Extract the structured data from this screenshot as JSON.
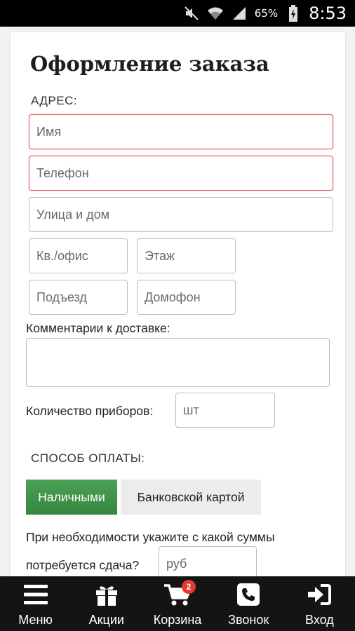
{
  "status_bar": {
    "battery_percent": "65%",
    "time": "8:53",
    "icons": [
      "mute-icon",
      "wifi-icon",
      "signal-icon",
      "battery-charging-icon"
    ]
  },
  "page": {
    "title": "Оформление заказа"
  },
  "address": {
    "label": "АДРЕС:",
    "name_placeholder": "Имя",
    "phone_placeholder": "Телефон",
    "street_placeholder": "Улица и дом",
    "apartment_placeholder": "Кв./офис",
    "floor_placeholder": "Этаж",
    "entrance_placeholder": "Подъезд",
    "intercom_placeholder": "Домофон"
  },
  "delivery": {
    "comment_label": "Комментарии к доставке:",
    "comment_value": "",
    "cutlery_label": "Количество приборов:",
    "cutlery_placeholder": "шт"
  },
  "payment": {
    "label": "СПОСОБ ОПЛАТЫ:",
    "options": [
      "Наличными",
      "Банковской картой"
    ],
    "selected": "Наличными",
    "change_line1": "При необходимости укажите с какой суммы",
    "change_line2": "потребуется сдача?",
    "change_placeholder": "руб"
  },
  "colors": {
    "accent_green": "#3d8f48",
    "error_red": "#e8525a",
    "nav_background": "#141414",
    "badge_red": "#e53935"
  },
  "bottom_nav": {
    "items": [
      {
        "label": "Меню",
        "icon": "menu-icon"
      },
      {
        "label": "Акции",
        "icon": "gift-icon"
      },
      {
        "label": "Корзина",
        "icon": "cart-icon"
      },
      {
        "label": "Звонок",
        "icon": "phone-icon"
      },
      {
        "label": "Вход",
        "icon": "login-icon"
      }
    ],
    "cart_badge": "2"
  }
}
